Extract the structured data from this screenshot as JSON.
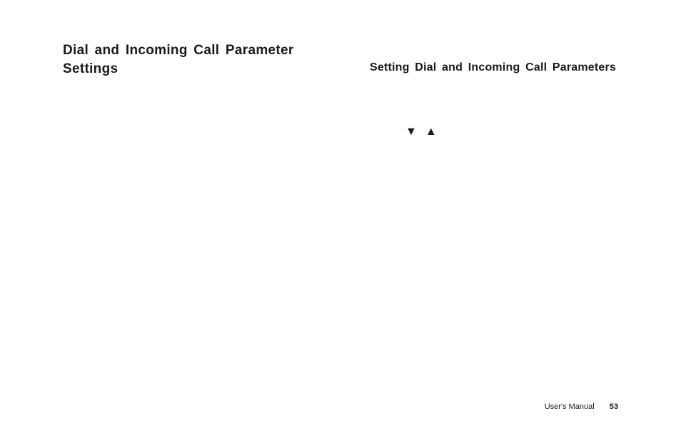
{
  "leftColumn": {
    "sectionTitle": "Dial and Incoming Call Parameter Settings"
  },
  "rightColumn": {
    "subTitle": "Setting Dial and Incoming Call Parameters"
  },
  "icons": {
    "downTriangle": "▼",
    "upTriangle": "▲"
  },
  "footer": {
    "label": "User's Manual",
    "pageNumber": "53"
  }
}
